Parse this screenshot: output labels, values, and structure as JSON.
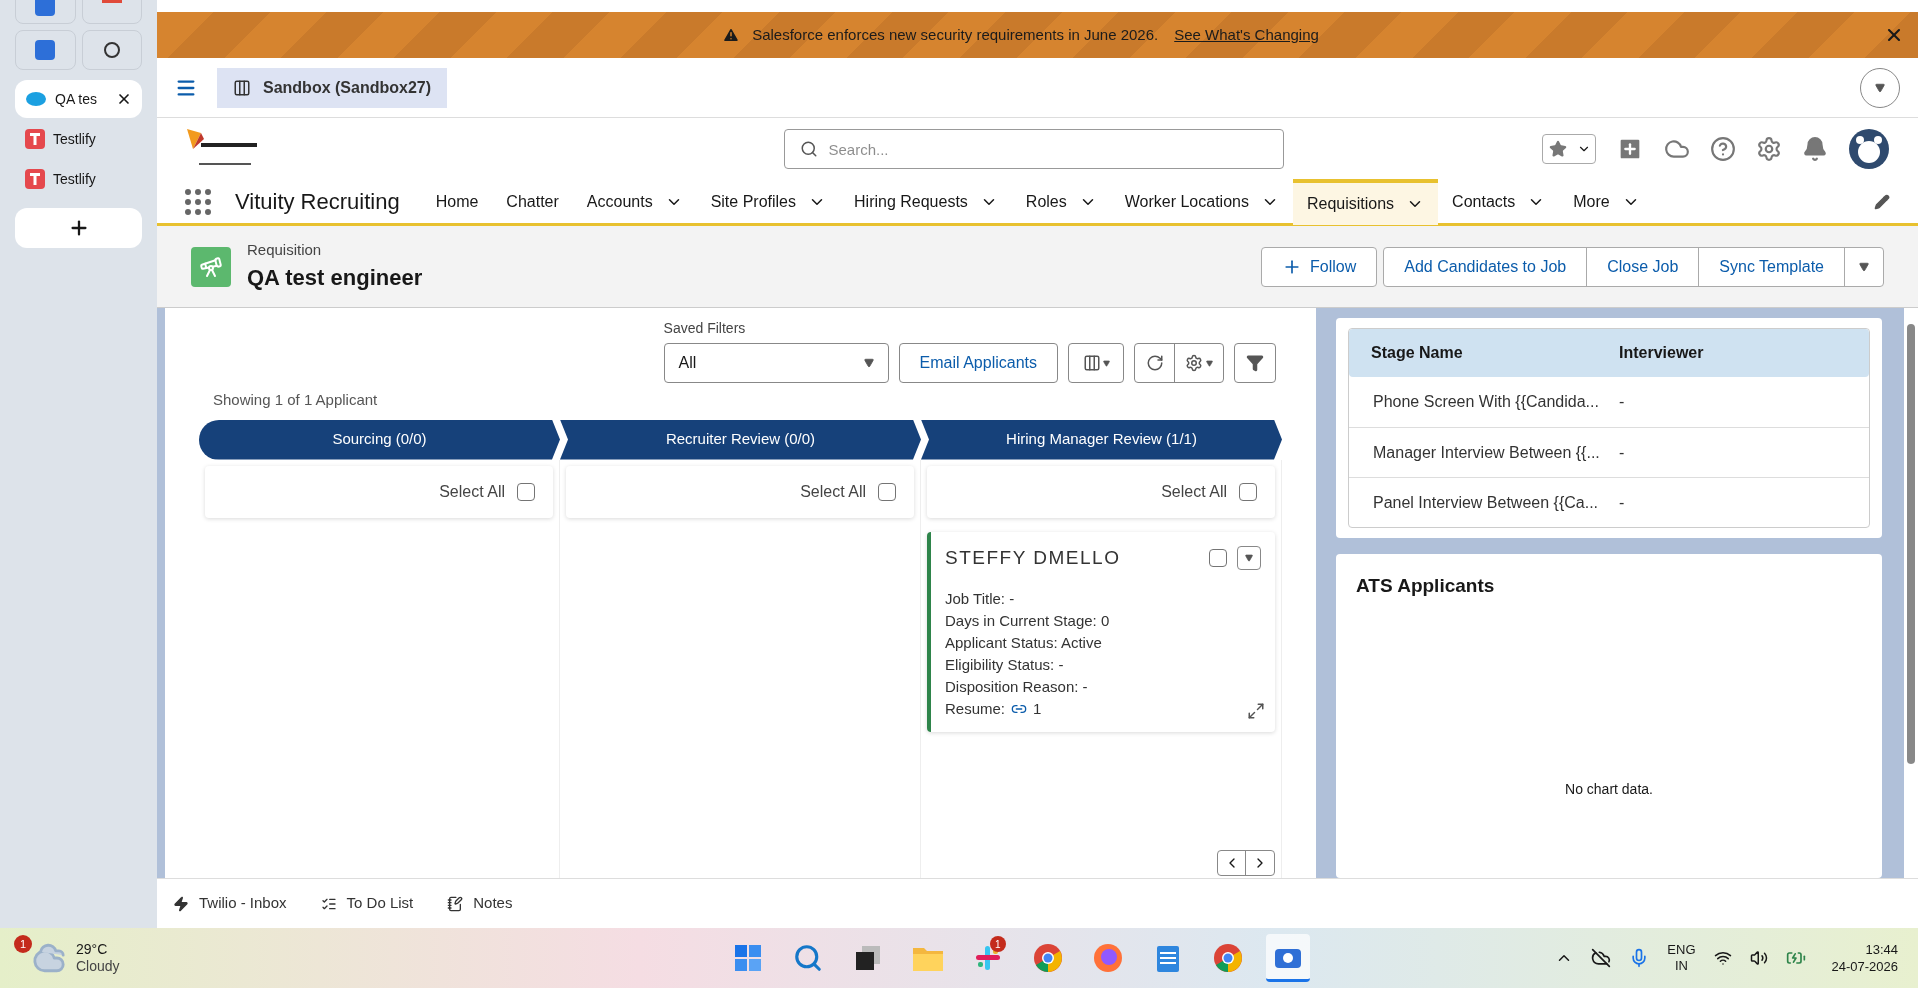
{
  "browser_tabs": [
    {
      "label": "QA tes",
      "kind": "salesforce",
      "selected": true,
      "closable": true
    },
    {
      "label": "Testlify",
      "kind": "testlify",
      "selected": false,
      "closable": false
    },
    {
      "label": "Testlify",
      "kind": "testlify",
      "selected": false,
      "closable": false
    }
  ],
  "banner": {
    "message": "Salesforce enforces new security requirements in June 2026.",
    "link": "See What's Changing"
  },
  "sandbox": {
    "label": "Sandbox (Sandbox27)"
  },
  "search": {
    "placeholder": "Search..."
  },
  "app_name": "Vituity Recruiting",
  "nav": [
    {
      "label": "Home",
      "dropdown": false,
      "selected": false
    },
    {
      "label": "Chatter",
      "dropdown": false,
      "selected": false
    },
    {
      "label": "Accounts",
      "dropdown": true,
      "selected": false
    },
    {
      "label": "Site Profiles",
      "dropdown": true,
      "selected": false
    },
    {
      "label": "Hiring Requests",
      "dropdown": true,
      "selected": false
    },
    {
      "label": "Roles",
      "dropdown": true,
      "selected": false
    },
    {
      "label": "Worker Locations",
      "dropdown": true,
      "selected": false
    },
    {
      "label": "Requisitions",
      "dropdown": true,
      "selected": true
    },
    {
      "label": "Contacts",
      "dropdown": true,
      "selected": false
    },
    {
      "label": "More",
      "dropdown": true,
      "selected": false
    }
  ],
  "record": {
    "type": "Requisition",
    "title": "QA test engineer",
    "actions": [
      "Add Candidates to Job",
      "Close Job",
      "Sync Template"
    ],
    "follow": "Follow"
  },
  "filters": {
    "label": "Saved Filters",
    "value": "All",
    "email_button": "Email Applicants"
  },
  "showing": "Showing 1 of 1 Applicant",
  "stages": [
    {
      "label": "Sourcing (0/0)",
      "select_all": "Select All",
      "checked": false
    },
    {
      "label": "Recruiter Review (0/0)",
      "select_all": "Select All",
      "checked": false
    },
    {
      "label": "Hiring Manager Review (1/1)",
      "select_all": "Select All",
      "checked": false,
      "cards": [
        {
          "name": "STEFFY DMELLO",
          "checked": false,
          "fields": [
            "Job Title: -",
            "Days in Current Stage: 0",
            "Applicant Status: Active",
            "Eligibility Status: -",
            "Disposition Reason: -"
          ],
          "resume_label": "Resume:",
          "resume_count": "1"
        }
      ]
    }
  ],
  "interviews": {
    "columns": [
      "Stage Name",
      "Interviewer"
    ],
    "rows": [
      [
        "Phone Screen With {{Candida...",
        "-"
      ],
      [
        "Manager Interview Between {{...",
        "-"
      ],
      [
        "Panel Interview Between {{Ca...",
        "-"
      ]
    ]
  },
  "ats": {
    "title": "ATS Applicants",
    "empty": "No chart data."
  },
  "utility_bar": [
    {
      "label": "Twilio - Inbox",
      "kind": "bolt"
    },
    {
      "label": "To Do List",
      "kind": "list"
    },
    {
      "label": "Notes",
      "kind": "notes"
    }
  ],
  "taskbar": {
    "weather": {
      "temp": "29°C",
      "condition": "Cloudy",
      "badge": "1"
    },
    "apps": [
      {
        "kind": "start",
        "selected": false
      },
      {
        "kind": "search",
        "selected": false
      },
      {
        "kind": "taskview",
        "selected": false
      },
      {
        "kind": "folder",
        "selected": false
      },
      {
        "kind": "slack",
        "selected": false,
        "badge": "1"
      },
      {
        "kind": "chrome",
        "selected": false
      },
      {
        "kind": "firefox",
        "selected": false
      },
      {
        "kind": "notepad",
        "selected": false
      },
      {
        "kind": "chrome",
        "selected": false
      },
      {
        "kind": "camera",
        "selected": true
      }
    ],
    "lang": "ENG",
    "region": "IN",
    "time": "13:44",
    "date": "24-07-2026"
  }
}
